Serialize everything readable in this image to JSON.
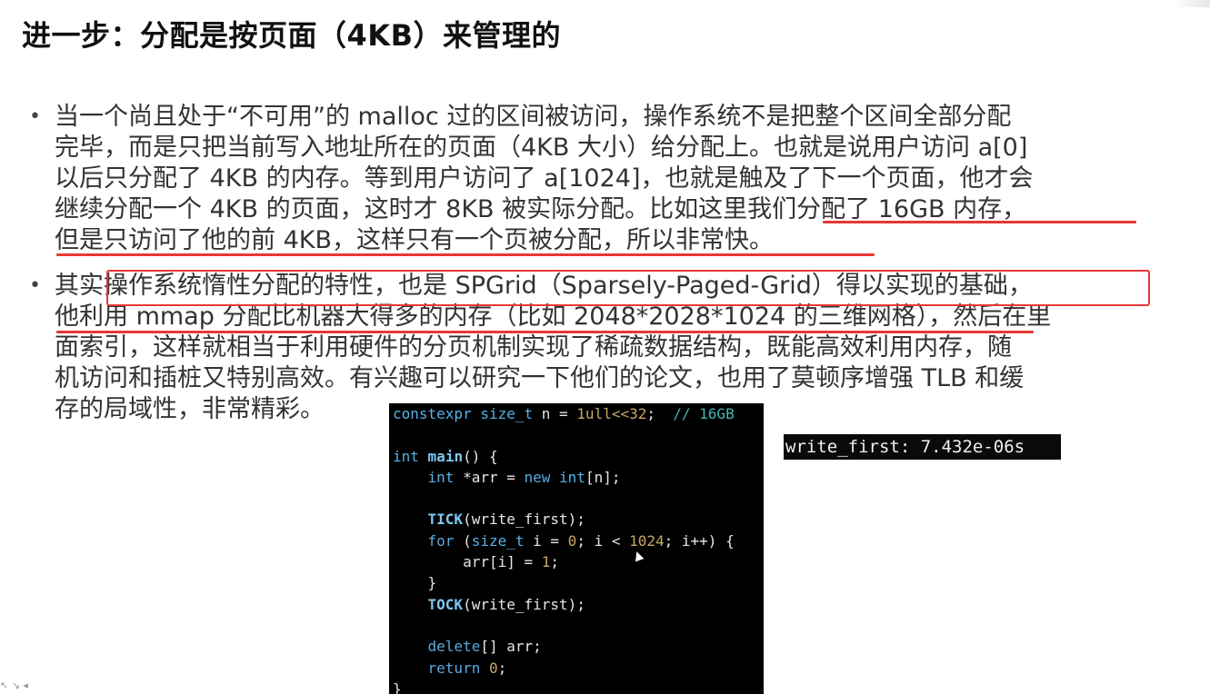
{
  "slide": {
    "title": "进一步：分配是按页面（4KB）来管理的"
  },
  "bullets": [
    {
      "lines": [
        "当一个尚且处于“不可用”的 malloc 过的区间被访问，操作系统不是把整个区间全部分配",
        "完毕，而是只把当前写入地址所在的页面（4KB 大小）给分配上。也就是说用户访问 a[0]",
        "以后只分配了 4KB 的内存。等到用户访问了 a[1024]，也就是触及了下一个页面，他才会",
        "继续分配一个 4KB 的页面，这时才 8KB 被实际分配。比如这里我们分配了 16GB 内存，",
        "但是只访问了他的前 4KB，这样只有一个页被分配，所以非常快。"
      ]
    },
    {
      "lines": [
        "其实操作系统惰性分配的特性，也是 SPGrid（Sparsely-Paged-Grid）得以实现的基础，",
        "他利用 mmap 分配比机器大得多的内存（比如 2048*2028*1024 的三维网格），然后在里",
        "面索引，这样就相当于利用硬件的分页机制实现了稀疏数据结构，既能高效利用内存，随",
        "机访问和插桩又特别高效。有兴趣可以研究一下他们的论文，也用了莫顿序增强 TLB 和缓",
        "存的局域性，非常精彩。"
      ]
    }
  ],
  "code": {
    "line1": {
      "type": "constexpr size_t",
      "name": " n = ",
      "value": "1ull<<32",
      "semi": ";  ",
      "comment": "// 16GB"
    },
    "line3": {
      "type": "int",
      "fn": "main",
      "rest": "() {"
    },
    "line4": {
      "type": "int",
      "rest1": " *arr = ",
      "kw": "new",
      "type2": "int",
      "rest2": "[n];"
    },
    "line6": {
      "fn": "TICK",
      "rest": "(write_first);"
    },
    "line7": {
      "kw": "for",
      "open": " (",
      "type": "size_t",
      "mid1": " i = ",
      "num1": "0",
      "mid2": "; i < ",
      "num2": "1024",
      "rest": "; i++) {"
    },
    "line8": {
      "rest": "arr[i] = ",
      "num": "1",
      "semi": ";"
    },
    "line9": {
      "rest": "}"
    },
    "line10": {
      "fn": "TOCK",
      "rest": "(write_first);"
    },
    "line12": {
      "kw": "delete",
      "rest": "[] arr;"
    },
    "line13": {
      "kw": "return",
      "num": "0",
      "semi": ";"
    },
    "line14": {
      "rest": "}"
    }
  },
  "output": {
    "text": "write_first: 7.432e-06s"
  },
  "corner": {
    "text": "↖ ↘ ◂"
  },
  "colors": {
    "annotation_red": "#e53935",
    "code_background": "#000000",
    "code_type": "#53b2e8",
    "code_number": "#c7a86a",
    "code_comment": "#3fb6b6"
  }
}
